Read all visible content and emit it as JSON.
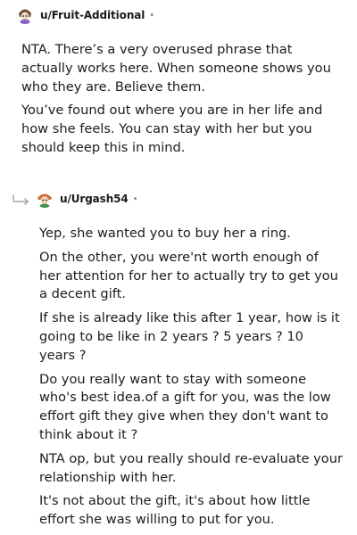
{
  "comment": {
    "username": "u/Fruit-Additional",
    "separator": "•",
    "paragraphs": [
      "NTA. There’s a very overused phrase that actually works here. When someone shows you who they are. Believe them.",
      "You’ve found out where you are in her life and how she feels. You can stay with her but you should keep this in mind."
    ]
  },
  "reply": {
    "username": "u/Urgash54",
    "separator": "•",
    "paragraphs": [
      "Yep, she wanted you to buy her a ring.",
      "On the other, you were'nt worth enough of her attention for her to actually try to get you a decent gift.",
      "If she is already like this after 1 year, how is it going to be like in 2 years ? 5 years ? 10 years ?",
      "Do you really want to stay with someone who's best idea.of a gift for you, was the low effort gift they give when they don't want to think about it ?",
      "NTA op, but you really should re-evaluate your relationship with her.",
      "It's not about the gift, it's about how little effort she was willing to put for you."
    ]
  },
  "icons": {
    "avatar1": "user-avatar-icon",
    "avatar2": "user-avatar-icon",
    "reply": "reply-arrow-icon"
  },
  "colors": {
    "text": "#1c1c1c",
    "muted": "#7c7c7c",
    "reply_arrow": "#9aa4ad"
  }
}
